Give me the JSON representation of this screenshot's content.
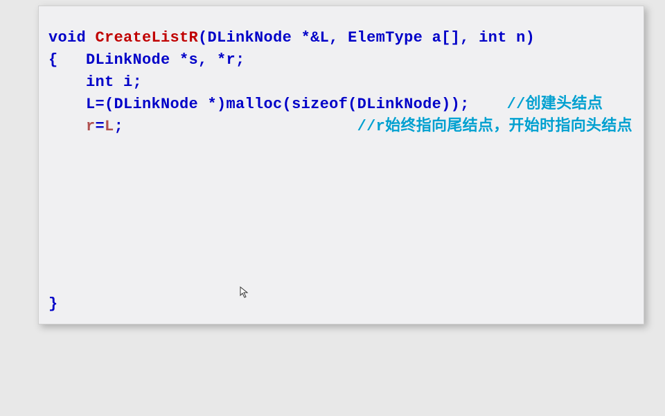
{
  "code": {
    "line1": {
      "void": "void ",
      "fn": "CreateListR",
      "sig": "(DLinkNode *&L, ElemType a[], int n)"
    },
    "line2": {
      "open": "{   ",
      "decl": "DLinkNode *s, *r;"
    },
    "line3": {
      "indent": "    ",
      "decl": "int i;"
    },
    "line4": {
      "indent": "    ",
      "body": "L=(DLinkNode *)malloc(sizeof(DLinkNode));",
      "gap": "    ",
      "comment": "//创建头结点"
    },
    "line5": {
      "indent": "    ",
      "r": "r",
      "eq": "=",
      "L": "L",
      "semi": ";",
      "gap": "                         ",
      "comment": "//r始终指向尾结点，开始时指向头结点"
    },
    "line6": {
      "close": "}"
    }
  }
}
